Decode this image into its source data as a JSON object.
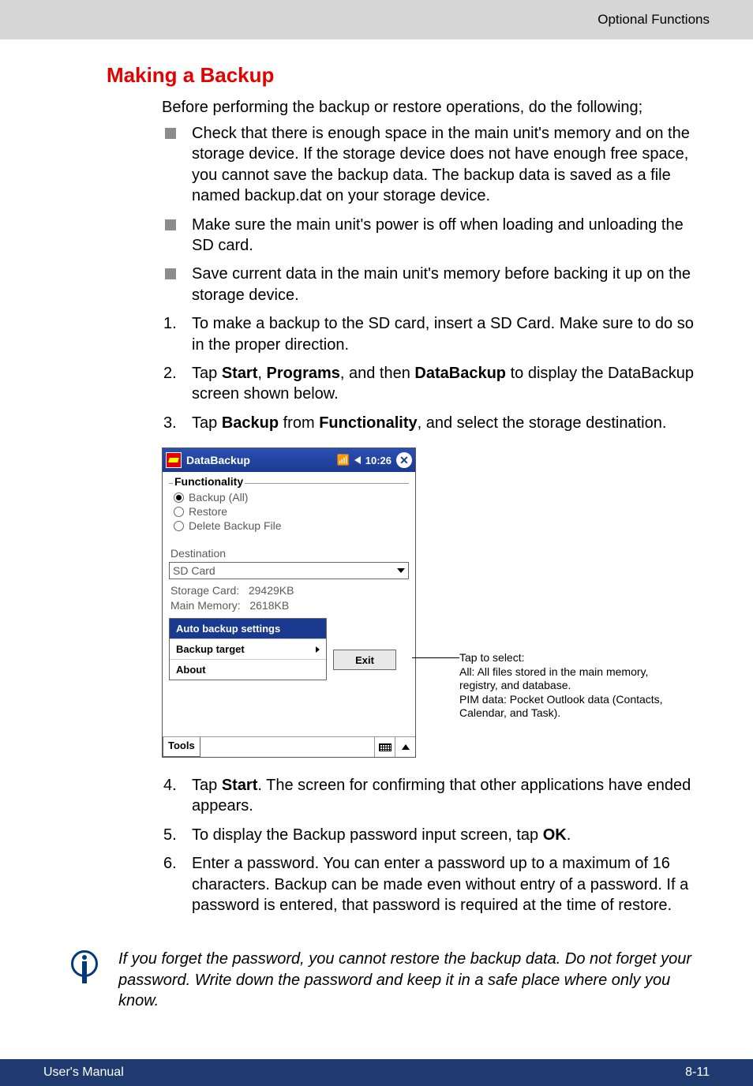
{
  "header": {
    "breadcrumb": "Optional Functions"
  },
  "section": {
    "title": "Making a Backup"
  },
  "intro": "Before performing the backup or restore operations, do the following;",
  "bullets": [
    "Check that there is enough space in the main unit's memory and on the storage device. If the storage device does not have enough free space, you cannot save the backup data. The backup data is saved as a file named backup.dat on your storage device.",
    "Make sure the main unit's power is off when loading and unloading the SD card.",
    "Save current data in the main unit's memory before backing it up on the storage device."
  ],
  "steps_a": [
    "To make a backup to the SD card, insert a SD Card. Make sure to do so in the proper direction.",
    {
      "pre": "Tap ",
      "b1": "Start",
      "m1": ", ",
      "b2": "Programs",
      "m2": ", and then ",
      "b3": "DataBackup",
      "post": " to display the DataBackup screen shown below."
    },
    {
      "pre": "Tap ",
      "b1": "Backup",
      "m1": " from ",
      "b2": "Functionality",
      "post": ", and select the storage destination."
    }
  ],
  "phone": {
    "title": "DataBackup",
    "time": "10:26",
    "functionality_label": "Functionality",
    "radios": [
      "Backup (All)",
      "Restore",
      "Delete Backup File"
    ],
    "destination_label": "Destination",
    "destination_value": "SD Card",
    "storage_label": "Storage Card:",
    "storage_value": "29429KB",
    "memory_label": "Main Memory:",
    "memory_value": "2618KB",
    "menu": {
      "auto": "Auto backup settings",
      "target": "Backup target",
      "about": "About",
      "exit": "Exit"
    },
    "tools": "Tools"
  },
  "callout": {
    "l1": "Tap to select:",
    "l2": "All: All files stored in the main memory, registry, and database.",
    "l3": "PIM data: Pocket Outlook data (Contacts, Calendar, and Task)."
  },
  "steps_b": [
    {
      "pre": "Tap ",
      "b1": "Start",
      "post": ". The screen for confirming that other applications have ended appears."
    },
    {
      "pre": "To display the Backup password input screen, tap ",
      "b1": "OK",
      "post": "."
    },
    "Enter a password. You can enter a password up to a maximum of 16 characters. Backup can be made even without entry of a password. If a password is entered, that password is required at the time of restore."
  ],
  "note": "If you forget the password, you cannot restore the backup data. Do not forget your password. Write down the password and keep it in a safe place where only you know.",
  "footer": {
    "left": "User's Manual",
    "right": "8-11"
  }
}
